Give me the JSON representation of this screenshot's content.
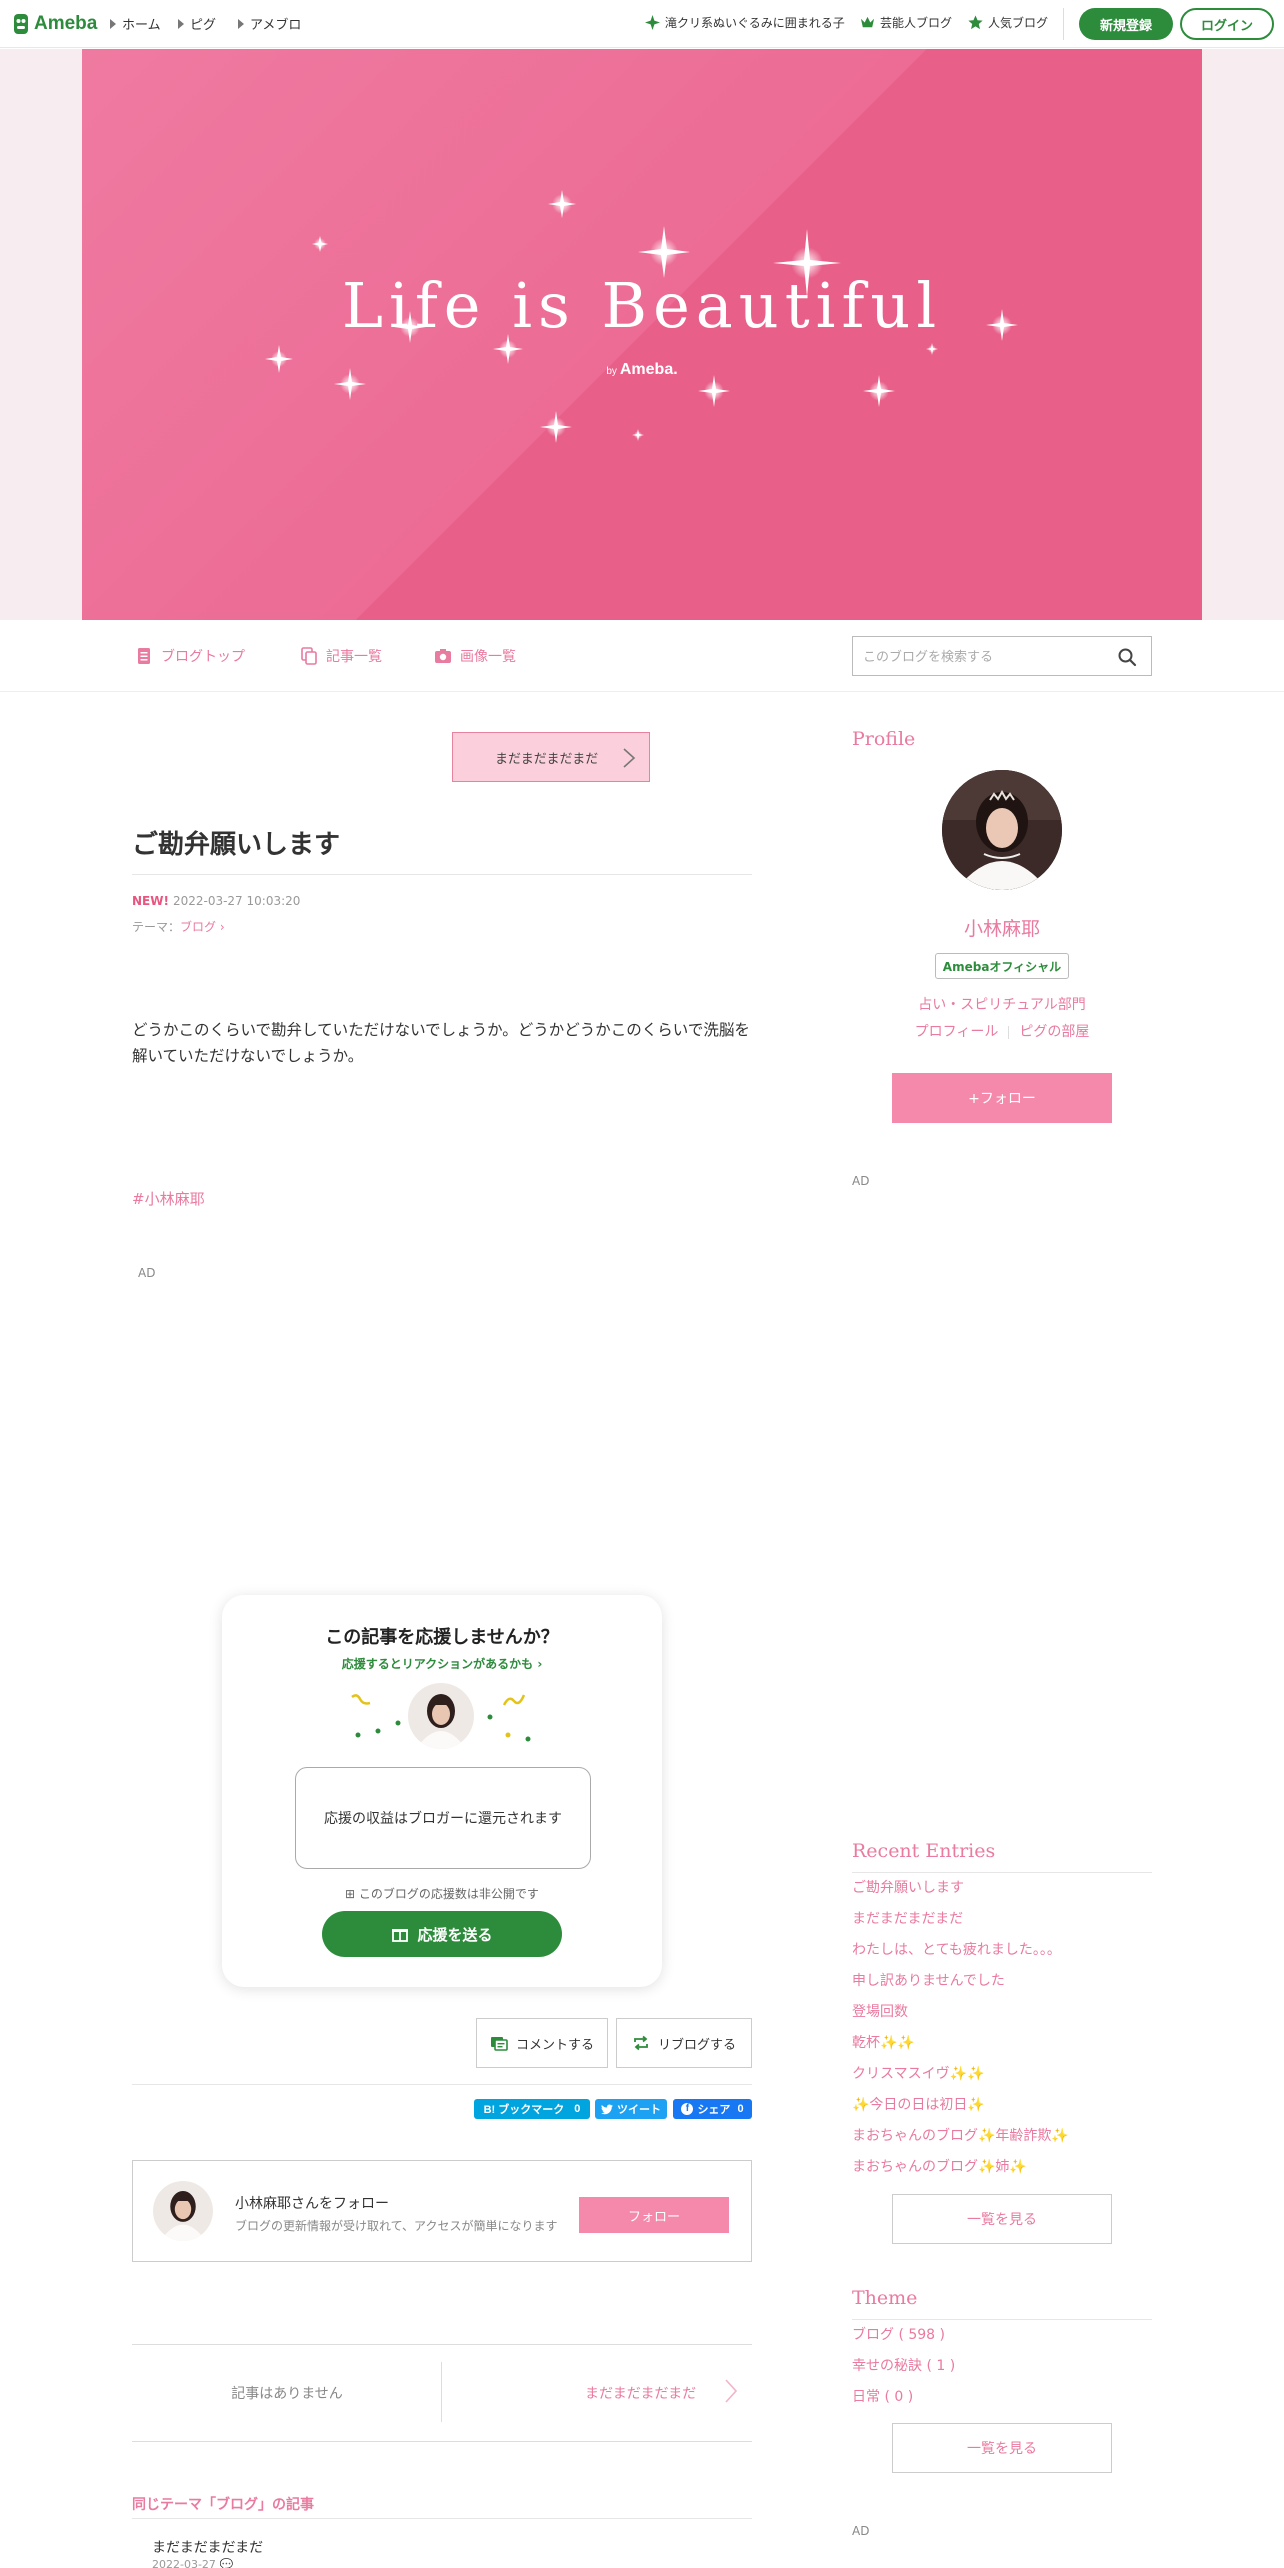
{
  "header": {
    "logo_text": "Ameba",
    "nav": [
      "ホーム",
      "ピグ",
      "アメブロ"
    ],
    "links": [
      {
        "label": "滝クリ系ぬいぐるみに囲まれる子",
        "icon": "sparkle-icon"
      },
      {
        "label": "芸能人ブログ",
        "icon": "crown-icon"
      },
      {
        "label": "人気ブログ",
        "icon": "star-icon"
      }
    ],
    "register_label": "新規登録",
    "login_label": "ログイン",
    "brand_color": "#2d8c3c"
  },
  "banner": {
    "title": "Life is Beautiful",
    "by": "by",
    "brand": "Ameba.",
    "color": "#ec6c95"
  },
  "blog_nav": {
    "items": [
      {
        "label": "ブログトップ",
        "icon": "document-icon"
      },
      {
        "label": "記事一覧",
        "icon": "copy-icon"
      },
      {
        "label": "画像一覧",
        "icon": "camera-icon"
      }
    ],
    "search_placeholder": "このブログを検索する"
  },
  "article": {
    "theme_nav_label": "まだまだまだまだ",
    "title": "ご勘弁願いします",
    "new_badge": "NEW!",
    "datetime": "2022-03-27 10:03:20",
    "theme_prefix": "テーマ：",
    "theme": "ブログ",
    "body": "どうかこのくらいで勘弁していただけないでしょうか。どうかどうかこのくらいで洗脳を解いていただけないでしょうか。",
    "hashtag": "#小林麻耶",
    "ad_label": "AD"
  },
  "support": {
    "title": "この記事を応援しませんか？",
    "subtitle": "応援するとリアクションがあるかも",
    "box_text": "応援の収益はブロガーに還元されます",
    "note": "このブログの応援数は非公開です",
    "button": "応援を送る"
  },
  "actions": {
    "comment": "コメントする",
    "reblog": "リブログする"
  },
  "share": [
    {
      "label": "B! ブックマーク",
      "count": "0",
      "color": "#00a4de"
    },
    {
      "label": "ツイート",
      "count": "",
      "color": "#1da1f2"
    },
    {
      "label": "シェア",
      "count": "0",
      "color": "#1877f2"
    }
  ],
  "follow_box": {
    "name": "小林麻耶さんをフォロー",
    "desc": "ブログの更新情報が受け取れて、アクセスが簡単になります",
    "button": "フォロー"
  },
  "prev_next": {
    "prev": "記事はありません",
    "next": "まだまだまだまだ"
  },
  "same_theme": {
    "title": "同じテーマ「ブログ」の記事",
    "first_item": "まだまだまだまだ",
    "first_date": "2022-03-27"
  },
  "sidebar": {
    "profile_heading": "Profile",
    "name": "小林麻耶",
    "badge": "Amebaオフィシャル",
    "category": "占い・スピリチュアル部門",
    "links": [
      "プロフィール",
      "ピグの部屋"
    ],
    "follow_button": "+フォロー",
    "ad_label": "AD",
    "recent_heading": "Recent Entries",
    "recent": [
      "ご勘弁願いします",
      "まだまだまだまだ",
      "わたしは、とても疲れました。。。",
      "申し訳ありませんでした",
      "登場回数",
      "乾杯✨✨",
      "クリスマスイヴ✨✨",
      "✨今日の日は初日✨",
      "まおちゃんのブログ✨年齢詐欺✨",
      "まおちゃんのブログ✨姉✨"
    ],
    "more_label": "一覧を見る",
    "theme_heading": "Theme",
    "themes": [
      "ブログ ( 598 )",
      "幸せの秘訣 ( 1 )",
      "日常 ( 0 )"
    ],
    "accent_color": "#e97aa0"
  }
}
